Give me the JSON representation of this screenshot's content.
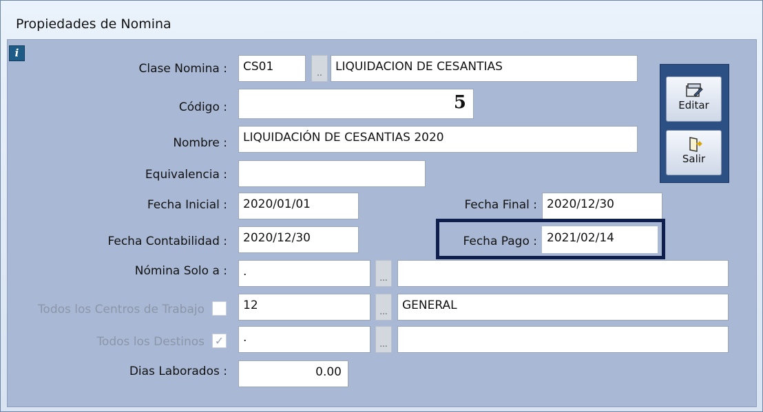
{
  "window": {
    "title": "Propiedades de Nomina"
  },
  "form": {
    "clase_nomina": {
      "label": "Clase Nomina :",
      "code": "CS01",
      "description": "LIQUIDACION DE CESANTIAS"
    },
    "codigo": {
      "label": "Código :",
      "value": "5"
    },
    "nombre": {
      "label": "Nombre :",
      "value": "LIQUIDACIÓN DE CESANTIAS 2020"
    },
    "equivalencia": {
      "label": "Equivalencia :",
      "value": ""
    },
    "fecha_inicial": {
      "label": "Fecha Inicial :",
      "value": "2020/01/01"
    },
    "fecha_final": {
      "label": "Fecha Final :",
      "value": "2020/12/30"
    },
    "fecha_contabilidad": {
      "label": "Fecha Contabilidad :",
      "value": "2020/12/30"
    },
    "fecha_pago": {
      "label": "Fecha Pago :",
      "value": "2021/02/14"
    },
    "nomina_solo_a": {
      "label": "Nómina Solo a :",
      "value": ".",
      "description": ""
    },
    "todos_centros": {
      "label": "Todos los Centros de Trabajo",
      "checked": false,
      "value": "12",
      "description": "GENERAL"
    },
    "todos_destinos": {
      "label": "Todos los Destinos",
      "checked": true,
      "value": ".",
      "description": ""
    },
    "dias_laborados": {
      "label": "Dias Laborados :",
      "value": "0.00"
    },
    "lookup_button_small": "..",
    "lookup_button": "..."
  },
  "toolbar": {
    "edit_label": "Editar",
    "exit_label": "Salir"
  },
  "colors": {
    "panel": "#a9b8d4",
    "button_panel": "#2c4f84",
    "highlight": "#0f1f4d"
  }
}
